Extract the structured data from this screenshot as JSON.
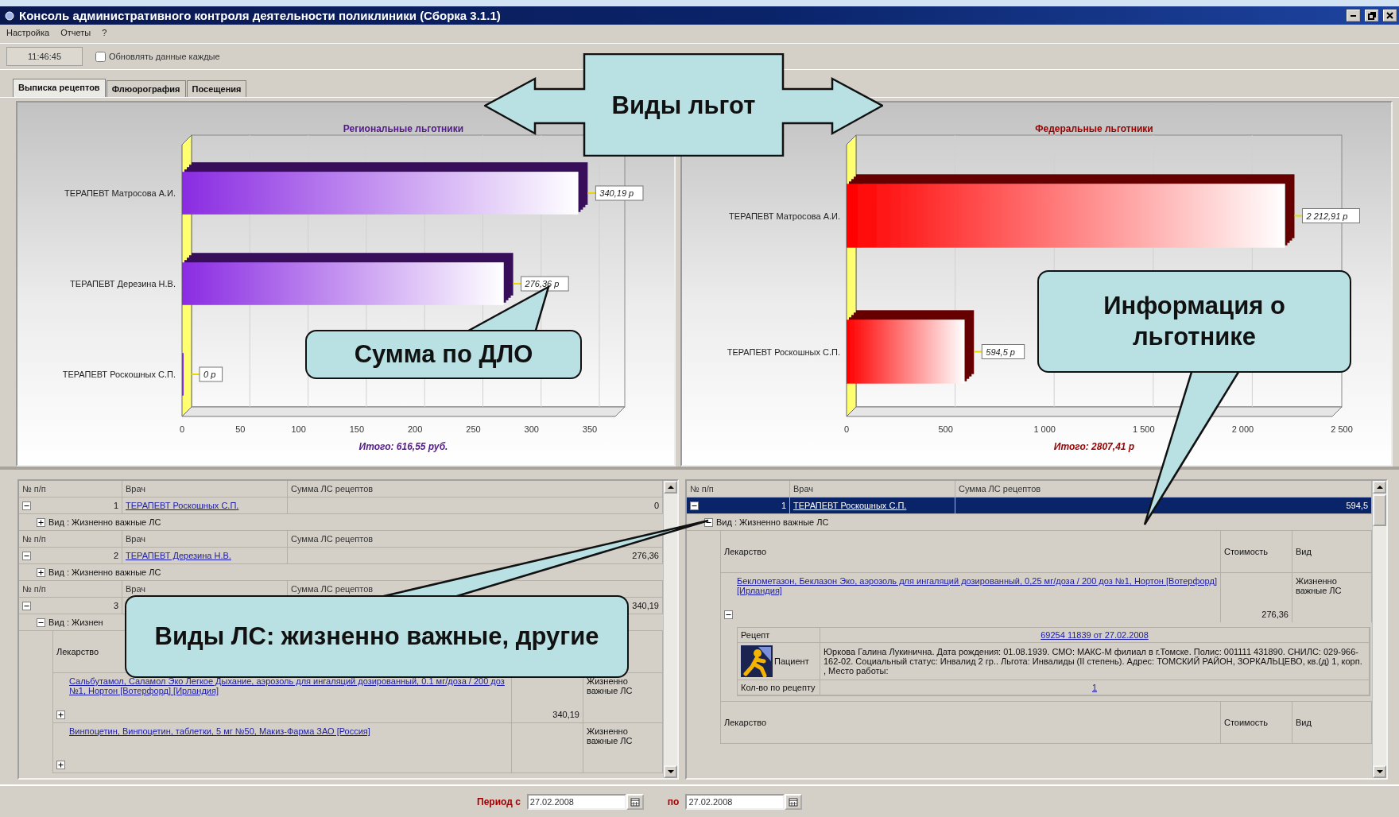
{
  "window": {
    "title": "Консоль административного контроля деятельности поликлиники (Сборка 3.1.1)"
  },
  "menu": [
    "Настройка",
    "Отчеты",
    "?"
  ],
  "toolbar": {
    "time": "11:46:45",
    "auto_refresh": {
      "label": "Обновлять данные каждые",
      "checked": false
    }
  },
  "tabs": [
    {
      "label": "Выписка рецептов",
      "selected": true
    },
    {
      "label": "Флюорография",
      "selected": false
    },
    {
      "label": "Посещения",
      "selected": false
    }
  ],
  "charts": [
    {
      "chart_data": {
        "type": "bar",
        "orientation": "horizontal",
        "title": "Региональные льготники",
        "xlabel": "Итого: 616,55 руб.",
        "categories": [
          "ТЕРАПЕВТ Матросова А.И.",
          "ТЕРАПЕВТ Дерезина Н.В.",
          "ТЕРАПЕВТ Роскошных С.П."
        ],
        "series": [
          {
            "color": "#8a2be2",
            "values": [
              340,
              276,
              0
            ]
          }
        ],
        "xlim": [
          0,
          380
        ],
        "xticks": [
          0,
          50,
          100,
          150,
          200,
          250,
          300,
          350
        ],
        "value_labels": [
          "340,19 р",
          "276,36 р",
          "0 р"
        ]
      }
    },
    {
      "chart_data": {
        "type": "bar",
        "orientation": "horizontal",
        "title": "Федеральные льготники",
        "xlabel": "Итого: 2807,41 р",
        "categories": [
          "ТЕРАПЕВТ Матросова А.И.",
          "ТЕРАПЕВТ Роскошных С.П."
        ],
        "series": [
          {
            "color": "#ff0000",
            "values": [
              2213,
              595
            ]
          }
        ],
        "xlim": [
          0,
          2500
        ],
        "xticks": [
          0,
          500,
          {
            "value": 1000,
            "label": "1 000"
          },
          {
            "value": 1500,
            "label": "1 500"
          },
          {
            "value": 2000,
            "label": "2 000"
          },
          {
            "value": 2500,
            "label": "2 500"
          }
        ],
        "value_labels": [
          "2 212,91 р",
          "594,5 р"
        ]
      }
    }
  ],
  "tables": [
    {
      "groups": [
        {
          "columns": [
            "№ п/п",
            "Врач",
            "Сумма ЛС рецептов"
          ],
          "number": "1",
          "doctor": "ТЕРАПЕВТ Роскошных С.П.",
          "sum": "0",
          "expanded": true,
          "selected": false,
          "category": {
            "label": "Вид : Жизненно важные ЛС",
            "expanded": false
          }
        },
        {
          "columns": [
            "№ п/п",
            "Врач",
            "Сумма ЛС рецептов"
          ],
          "number": "2",
          "doctor": "ТЕРАПЕВТ Дерезина Н.В.",
          "sum": "276,36",
          "expanded": true,
          "selected": false,
          "category": {
            "label": "Вид : Жизненно важные ЛС",
            "expanded": false
          }
        },
        {
          "columns": [
            "№ п/п",
            "Врач",
            "Сумма ЛС рецептов"
          ],
          "number": "3",
          "sum": "340,19",
          "expanded": true,
          "selected": false,
          "category": {
            "label": "Вид : Жизнен",
            "expanded": true,
            "drug_tables": [
              {
                "columns": [
                  "Лекарство"
                ],
                "rows": [
                  {
                    "name": "Сальбутамол, Саламол Эко Легкое Дыхание, аэрозоль для ингаляций дозированный, 0.1 мг/доза / 200 доз №1, Нортон [Вотерфорд] [Ирландия]",
                    "cost": "340,19",
                    "type": "Жизненно важные ЛС",
                    "expanded": false
                  },
                  {
                    "name": "Винпоцетин, Винпоцетин, таблетки, 5 мг №50, Макиз-Фарма ЗАО [Россия]",
                    "type": "Жизненно важные ЛС",
                    "expanded": false
                  }
                ]
              }
            ]
          }
        }
      ]
    },
    {
      "groups": [
        {
          "columns": [
            "№ п/п",
            "Врач",
            "Сумма ЛС рецептов"
          ],
          "number": "1",
          "doctor": "ТЕРАПЕВТ Роскошных С.П.",
          "sum": "594,5",
          "expanded": true,
          "selected": true,
          "category": {
            "label": "Вид : Жизненно важные ЛС",
            "expanded": true,
            "drug_tables": [
              {
                "columns": [
                  "Лекарство",
                  "Стоимость",
                  "Вид"
                ],
                "rows": [
                  {
                    "name": "Беклометазон, Беклазон Эко, аэрозоль для ингаляций дозированный, 0,25 мг/доза / 200 доз №1, Нортон [Вотерфорд] [Ирландия]",
                    "cost": "276,36",
                    "type": "Жизненно важные ЛС",
                    "expanded": true,
                    "details": {
                      "prescription_label": "Рецепт",
                      "prescription": "69254 11839 от 27.02.2008",
                      "patient_label": "Пациент",
                      "patient": "Юркова Галина Лукинична. Дата рождения: 01.08.1939. СМО: МАКС-М филиал в г.Томске. Полис: 001111 431890. СНИЛС: 029-966-162-02. Социальный статус: Инвалид 2 гр.. Льгота: Инвалиды (II степень). Адрес: ТОМСКИЙ РАЙОН, ЗОРКАЛЬЦЕВО, кв.(д) 1, корп. , Место работы:",
                      "quantity_label": "Кол-во по рецепту",
                      "quantity": "1"
                    }
                  }
                ]
              },
              {
                "columns": [
                  "Лекарство",
                  "Стоимость",
                  "Вид"
                ]
              }
            ]
          }
        }
      ]
    }
  ],
  "period": {
    "from_label": "Период с",
    "from": "27.02.2008",
    "to_label": "по",
    "to": "27.02.2008"
  },
  "callouts": [
    {
      "kind": "double_arrow",
      "text": "Виды льгот"
    },
    {
      "kind": "bubble",
      "text": "Сумма по ДЛО"
    },
    {
      "kind": "bubble",
      "text": "Информация о льготнике"
    },
    {
      "kind": "bubble",
      "text": "Виды ЛС: жизненно важные, другие"
    }
  ]
}
